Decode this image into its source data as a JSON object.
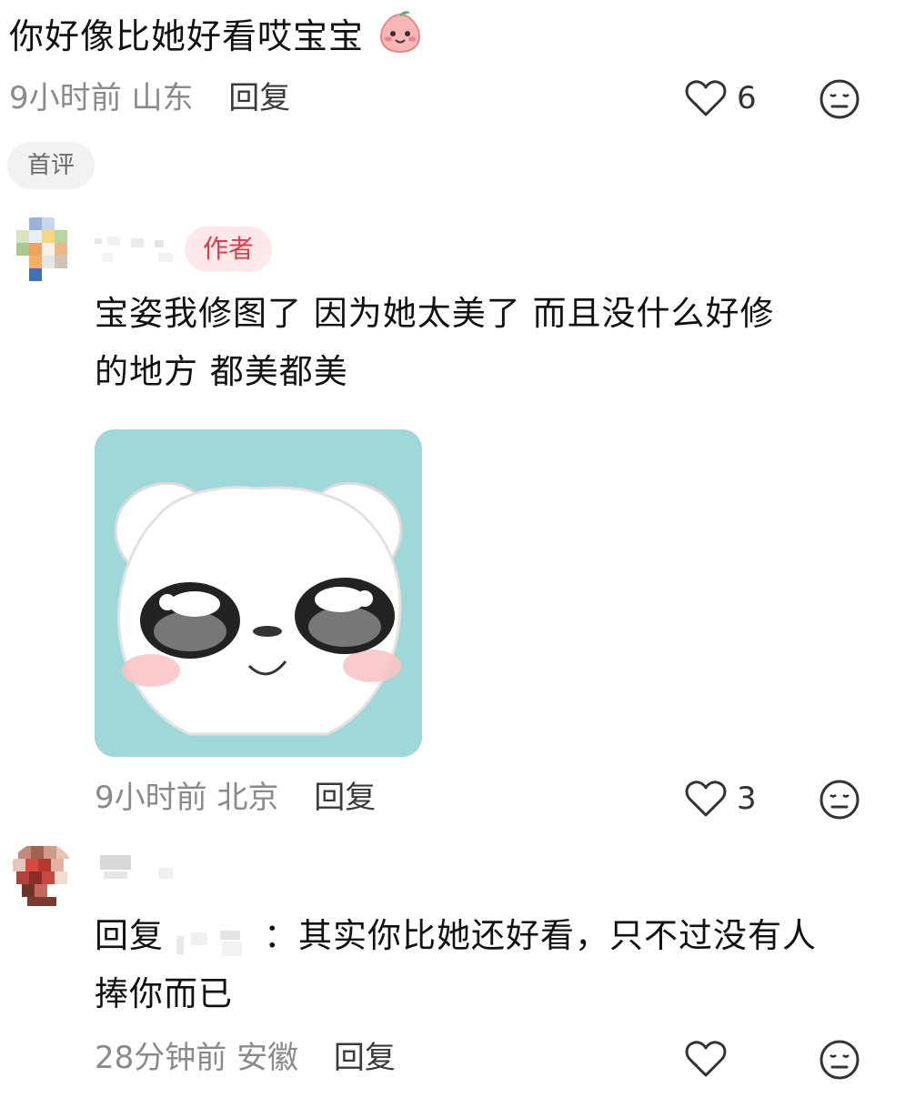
{
  "top_comment": {
    "text": "你好像比她好看哎宝宝",
    "emoji_icon": "peach-smile-emoji",
    "time": "9小时前",
    "location": "山东",
    "reply_label": "回复",
    "likes": "6",
    "first_badge": "首评"
  },
  "author_reply": {
    "author_badge": "作者",
    "text_line1": "宝姿我修图了 因为她太美了 而且没什么好修",
    "text_line2": "的地方 都美都美",
    "sticker_icon": "white-puppy-sticker",
    "time": "9小时前",
    "location": "北京",
    "reply_label": "回复",
    "likes": "3"
  },
  "third_reply": {
    "reply_prefix": "回复",
    "text_rest": "：其实你比她还好看，只不过没有人",
    "text_line2": "捧你而已",
    "time": "28分钟前",
    "location": "安徽",
    "reply_label": "回复",
    "likes": ""
  },
  "colors": {
    "meta": "#8a8a8a",
    "author_badge_bg": "#fde8ea",
    "author_badge_text": "#e23a4c",
    "sticker_bg": "#9fd8d8"
  }
}
